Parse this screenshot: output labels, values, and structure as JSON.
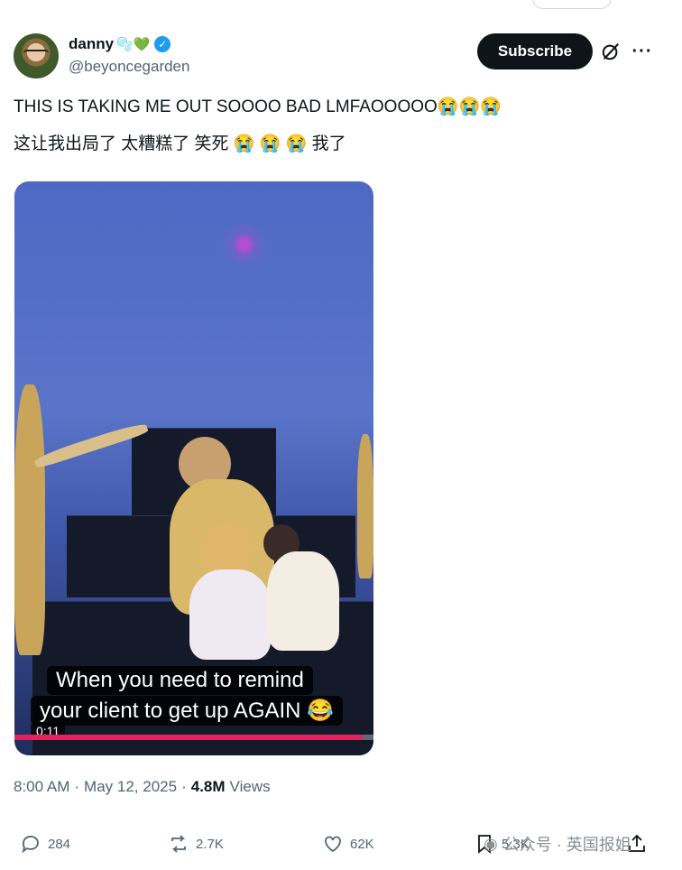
{
  "author": {
    "display_name": "danny",
    "emoji": "🫧💚",
    "handle": "@beyoncegarden"
  },
  "subscribe_label": "Subscribe",
  "tweet": {
    "line1": "THIS IS TAKING ME OUT SOOOO BAD LMFAOOOOO😭😭😭",
    "line2": "这让我出局了 太糟糕了 笑死 😭  😭  😭 我了"
  },
  "video": {
    "caption_line1": "When you need to remind",
    "caption_line2": "your client to get up AGAIN 😂",
    "timecode": "0:11",
    "progress": 0.97
  },
  "meta": {
    "time": "8:00 AM",
    "date": "May 12, 2025",
    "separator": "·",
    "views_count": "4.8M",
    "views_label": "Views"
  },
  "actions": {
    "replies": "284",
    "reposts": "2.7K",
    "likes": "62K",
    "bookmarks": "5.3K"
  },
  "watermark": "公众号 · 英国报姐",
  "icons": [
    "verified-icon",
    "grok-icon",
    "more-icon",
    "reply-icon",
    "repost-icon",
    "like-icon",
    "bookmark-icon",
    "share-icon"
  ],
  "colors": {
    "verified": "#1d9bf0",
    "button_bg": "#0f1419",
    "secondary_text": "#536471",
    "progress": "#e0245e"
  }
}
